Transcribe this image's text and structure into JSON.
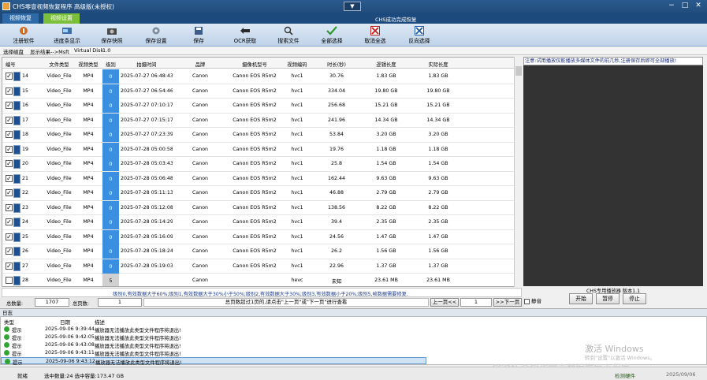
{
  "window": {
    "title": "CHS零壹视频恢复程序 高级版(未授权)",
    "dropdown_label": "▼",
    "controls": {
      "minimize": "−",
      "maximize": "□",
      "close": "✕"
    }
  },
  "tabs": [
    {
      "label": "视频恢复"
    },
    {
      "label": "视频设置"
    }
  ],
  "success_message": "CHS成功完成恢复",
  "toolbar": [
    {
      "label": "注册软件",
      "icon": "register-icon"
    },
    {
      "label": "进度条显示",
      "icon": "progress-icon"
    },
    {
      "label": "保存快照",
      "icon": "snapshot-icon"
    },
    {
      "label": "保存设置",
      "icon": "settings-icon"
    },
    {
      "label": "保存",
      "icon": "save-icon"
    },
    {
      "label": "OCR获取",
      "icon": "ocr-icon"
    },
    {
      "label": "搜索文件",
      "icon": "search-icon"
    },
    {
      "label": "全部选择",
      "icon": "select-all-icon"
    },
    {
      "label": "取消全选",
      "icon": "deselect-icon"
    },
    {
      "label": "反向选择",
      "icon": "invert-select-icon"
    }
  ],
  "path": {
    "label": "选择磁盘",
    "result": "显示结果-->Msft",
    "disk": "Virtual Disk",
    "version": "1.0"
  },
  "table": {
    "columns": [
      "编号",
      "文件类型",
      "视频类型",
      "级别",
      "拍摄时间",
      "品牌",
      "摄像机型号",
      "视频编码",
      "时长(秒)",
      "逻辑长度",
      "实际长度"
    ],
    "rows": [
      {
        "no": "14",
        "filetype": "Video_File",
        "vtype": "MP4",
        "level": "0",
        "time": "2025-07-27 06:48:43",
        "brand": "Canon",
        "model": "Canon EOS R5m2",
        "codec": "hvc1",
        "duration": "30.76",
        "logical": "1.83 GB",
        "actual": "1.83 GB",
        "checked": true
      },
      {
        "no": "15",
        "filetype": "Video_File",
        "vtype": "MP4",
        "level": "0",
        "time": "2025-07-27 06:54:46",
        "brand": "Canon",
        "model": "Canon EOS R5m2",
        "codec": "hvc1",
        "duration": "334.04",
        "logical": "19.80 GB",
        "actual": "19.80 GB",
        "checked": true
      },
      {
        "no": "16",
        "filetype": "Video_File",
        "vtype": "MP4",
        "level": "0",
        "time": "2025-07-27 07:10:17",
        "brand": "Canon",
        "model": "Canon EOS R5m2",
        "codec": "hvc1",
        "duration": "256.68",
        "logical": "15.21 GB",
        "actual": "15.21 GB",
        "checked": true
      },
      {
        "no": "17",
        "filetype": "Video_File",
        "vtype": "MP4",
        "level": "0",
        "time": "2025-07-27 07:15:17",
        "brand": "Canon",
        "model": "Canon EOS R5m2",
        "codec": "hvc1",
        "duration": "241.96",
        "logical": "14.34 GB",
        "actual": "14.34 GB",
        "checked": true
      },
      {
        "no": "18",
        "filetype": "Video_File",
        "vtype": "MP4",
        "level": "0",
        "time": "2025-07-27 07:23:39",
        "brand": "Canon",
        "model": "Canon EOS R5m2",
        "codec": "hvc1",
        "duration": "53.84",
        "logical": "3.20 GB",
        "actual": "3.20 GB",
        "checked": true
      },
      {
        "no": "19",
        "filetype": "Video_File",
        "vtype": "MP4",
        "level": "0",
        "time": "2025-07-28 05:00:58",
        "brand": "Canon",
        "model": "Canon EOS R5m2",
        "codec": "hvc1",
        "duration": "19.76",
        "logical": "1.18 GB",
        "actual": "1.18 GB",
        "checked": true
      },
      {
        "no": "20",
        "filetype": "Video_File",
        "vtype": "MP4",
        "level": "0",
        "time": "2025-07-28 05:03:43",
        "brand": "Canon",
        "model": "Canon EOS R5m2",
        "codec": "hvc1",
        "duration": "25.8",
        "logical": "1.54 GB",
        "actual": "1.54 GB",
        "checked": true
      },
      {
        "no": "21",
        "filetype": "Video_File",
        "vtype": "MP4",
        "level": "0",
        "time": "2025-07-28 05:06:48",
        "brand": "Canon",
        "model": "Canon EOS R5m2",
        "codec": "hvc1",
        "duration": "162.44",
        "logical": "9.63 GB",
        "actual": "9.63 GB",
        "checked": true
      },
      {
        "no": "22",
        "filetype": "Video_File",
        "vtype": "MP4",
        "level": "0",
        "time": "2025-07-28 05:11:13",
        "brand": "Canon",
        "model": "Canon EOS R5m2",
        "codec": "hvc1",
        "duration": "46.88",
        "logical": "2.79 GB",
        "actual": "2.79 GB",
        "checked": true
      },
      {
        "no": "23",
        "filetype": "Video_File",
        "vtype": "MP4",
        "level": "0",
        "time": "2025-07-28 05:12:08",
        "brand": "Canon",
        "model": "Canon EOS R5m2",
        "codec": "hvc1",
        "duration": "138.56",
        "logical": "8.22 GB",
        "actual": "8.22 GB",
        "checked": true
      },
      {
        "no": "24",
        "filetype": "Video_File",
        "vtype": "MP4",
        "level": "0",
        "time": "2025-07-28 05:14:29",
        "brand": "Canon",
        "model": "Canon EOS R5m2",
        "codec": "hvc1",
        "duration": "39.4",
        "logical": "2.35 GB",
        "actual": "2.35 GB",
        "checked": true
      },
      {
        "no": "25",
        "filetype": "Video_File",
        "vtype": "MP4",
        "level": "0",
        "time": "2025-07-28 05:16:09",
        "brand": "Canon",
        "model": "Canon EOS R5m2",
        "codec": "hvc1",
        "duration": "24.56",
        "logical": "1.47 GB",
        "actual": "1.47 GB",
        "checked": true
      },
      {
        "no": "26",
        "filetype": "Video_File",
        "vtype": "MP4",
        "level": "0",
        "time": "2025-07-28 05:18:24",
        "brand": "Canon",
        "model": "Canon EOS R5m2",
        "codec": "hvc1",
        "duration": "26.2",
        "logical": "1.56 GB",
        "actual": "1.56 GB",
        "checked": true
      },
      {
        "no": "27",
        "filetype": "Video_File",
        "vtype": "MP4",
        "level": "0",
        "time": "2025-07-28 05:19:03",
        "brand": "Canon",
        "model": "Canon EOS R5m2",
        "codec": "hvc1",
        "duration": "22.96",
        "logical": "1.37 GB",
        "actual": "1.37 GB",
        "checked": true
      },
      {
        "no": "28",
        "filetype": "Video_File",
        "vtype": "MP4",
        "level": "5",
        "time": "",
        "brand": "Canon",
        "model": "",
        "codec": "hevc",
        "duration": "未知",
        "logical": "23.61 MB",
        "actual": "23.61 MB",
        "checked": false
      }
    ]
  },
  "level_legend": "级别0,有效数据大于60%;级别1,有效数据大于30%小于50%;级别2,有效数据大于30%;级别3,有效数据小于20%;级别5,帧数据需要修复.",
  "pager": {
    "total_label": "总数量:",
    "total_value": "1707",
    "pages_label": "总页数:",
    "pages_value": "1",
    "hint": "总页数超过1页的,请点击\"上一页\"或\"下一页\"进行查看",
    "prev": "上一页<<",
    "current": "1",
    "next": ">>下一页"
  },
  "right_panel": {
    "note": "注意:试用播放仅能播放多媒体文件的前几秒,注册保存后即可全部播放!",
    "player_label": "CHS专用播放器 版本1.1",
    "mute_label": "静音",
    "start": "开始",
    "pause": "暂停",
    "stop": "停止"
  },
  "log": {
    "title": "日志",
    "columns": [
      "类型",
      "日期",
      "描述"
    ],
    "rows": [
      {
        "type": "提示",
        "date": "2025-09-06 9:39:44",
        "desc": "播放器无法播放此类型文件程序将退出!"
      },
      {
        "type": "提示",
        "date": "2025-09-06 9:42:05",
        "desc": "播放器无法播放此类型文件程序将退出!"
      },
      {
        "type": "提示",
        "date": "2025-09-06 9:43:08",
        "desc": "播放器无法播放此类型文件程序将退出!"
      },
      {
        "type": "提示",
        "date": "2025-09-06 9:43:11",
        "desc": "播放器无法播放此类型文件程序将退出!"
      },
      {
        "type": "提示",
        "date": "2025-09-06 9:43:12",
        "desc": "播放器无法播放此类型文件程序将退出!"
      }
    ]
  },
  "watermark": {
    "line1": "激活 Windows",
    "line2": "转到\"设置\"以激活 Windows。",
    "csdn": "CSDN @CHS零壹数据恢复小程序"
  },
  "statusbar": {
    "state": "就绪",
    "selection": "选中数量:24 选中容量:173.47 GB",
    "right_label": "检测硬件",
    "date": "2025/09/06"
  },
  "colors": {
    "accent": "#1d4a7d",
    "level_bg": "#3b8fe0",
    "tab_green": "#7bbf3a"
  }
}
